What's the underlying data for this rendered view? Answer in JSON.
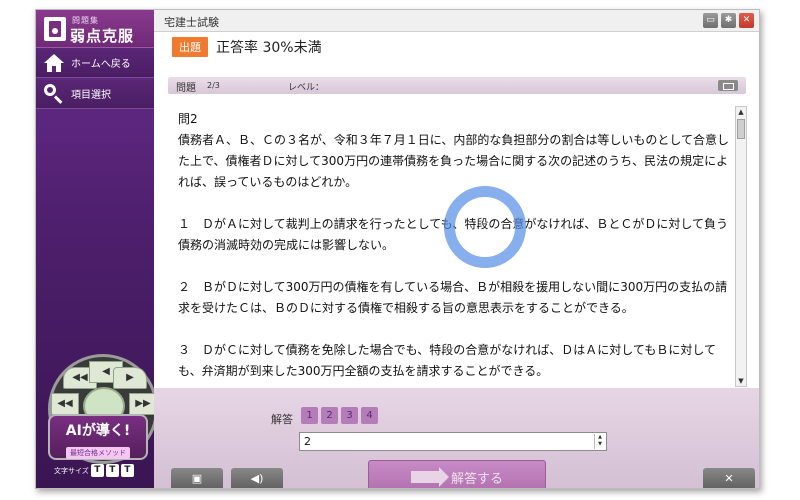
{
  "sidebar": {
    "logo_sub": "問題集",
    "logo_main": "弱点克服",
    "items": [
      {
        "label": "ホームへ戻る",
        "icon": "home-icon"
      },
      {
        "label": "項目選択",
        "icon": "search-icon"
      }
    ],
    "dial": {
      "top_left": "◀◀",
      "top_mid": "◀",
      "top_right": "▶",
      "mid_left": "◀◀",
      "mid_right": "▶▶"
    },
    "ai_title": "AIが導く!",
    "ai_sub": "最短合格メソッド",
    "fontsize_label": "文字サイズ",
    "fontsize_buttons": [
      "T",
      "T",
      "T"
    ]
  },
  "window": {
    "title": "宅建士試験",
    "buttons": [
      "folder-icon",
      "gear-icon",
      "close-icon"
    ]
  },
  "header": {
    "tag": "出題",
    "text": "正答率 30%未満"
  },
  "question_bar": {
    "label": "問題",
    "count": "2/3",
    "level_label": "レベル："
  },
  "question": {
    "number": "問2",
    "paragraphs": [
      "債務者Ａ、Ｂ、Ｃの３名が、令和３年７月１日に、内部的な負担部分の割合は等しいものとして合意した上で、債権者Ｄに対して300万円の連帯債務を負った場合に関する次の記述のうち、民法の規定によれば、誤っているものはどれか。",
      "１　ＤがＡに対して裁判上の請求を行ったとしても、特段の合意がなければ、ＢとＣがＤに対して負う債務の消滅時効の完成には影響しない。",
      "２　ＢがＤに対して300万円の債権を有している場合、Ｂが相殺を援用しない間に300万円の支払の請求を受けたＣは、ＢのＤに対する債権で相殺する旨の意思表示をすることができる。",
      "３　ＤがＣに対して債務を免除した場合でも、特段の合意がなければ、ＤはＡに対してもＢに対しても、弁済期が到来した300万円全額の支払を請求することができる。"
    ]
  },
  "answer": {
    "label": "解答",
    "choices": [
      "1",
      "2",
      "3",
      "4"
    ],
    "input_value": "2",
    "submit_label": "解答する"
  },
  "colors": {
    "sidebar": "#4e1f6d",
    "accent_orange": "#f07a2f",
    "answer_area": "#dcc9db",
    "spinner": "#548ce6"
  }
}
